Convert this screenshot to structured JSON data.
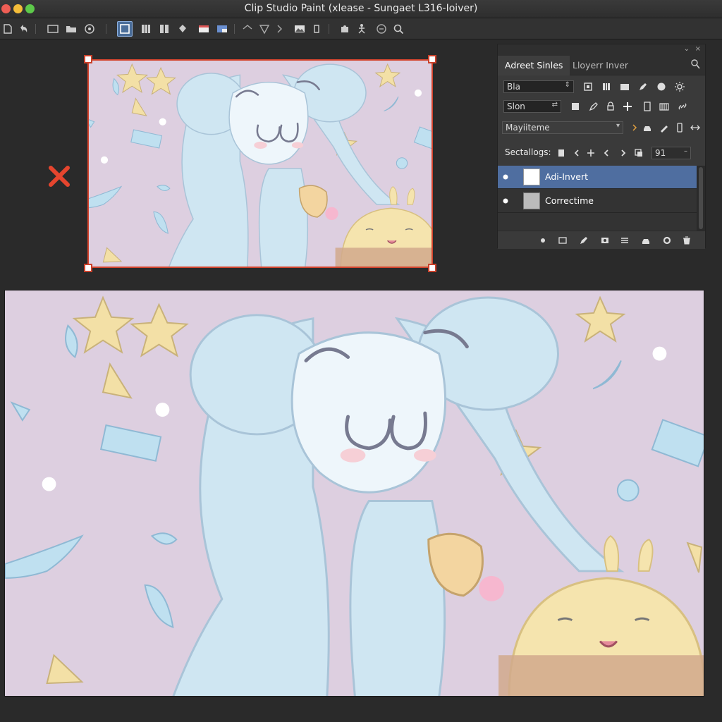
{
  "window": {
    "title": "Clip Studio Paint (xlease - Sungaet L316-Ioiver)"
  },
  "panel": {
    "tabs": [
      {
        "label": "Adreet Sinles"
      },
      {
        "label": "Lloyerr Inver"
      }
    ],
    "row1": {
      "field_value": "Bla"
    },
    "row2": {
      "field_value": "Slon"
    },
    "row3": {
      "dropdown_value": "Mayiiteme"
    },
    "row4": {
      "label": "Sectallogs:",
      "opacity_value": "91"
    },
    "layers": [
      {
        "name": "Adi-Invert",
        "selected": true
      },
      {
        "name": "Correctime",
        "selected": false
      }
    ]
  },
  "colors": {
    "accent_frame": "#d3442d",
    "selection": "#4f6ea0",
    "canvas_bg": "#ddcfe0",
    "character": "#cfe6f2"
  }
}
